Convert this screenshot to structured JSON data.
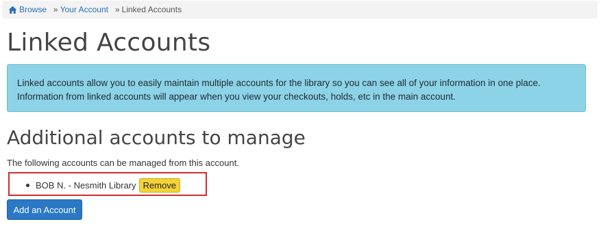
{
  "breadcrumb": {
    "home_label": "Browse",
    "home_icon": "home-icon",
    "separator": "»",
    "items": [
      {
        "label": "Your Account"
      },
      {
        "label": "Linked Accounts"
      }
    ]
  },
  "page_title": "Linked Accounts",
  "info_alert": {
    "line1": "Linked accounts allow you to easily maintain multiple accounts for the library so you can see all of your information in one place.",
    "line2": "Information from linked accounts will appear when you view your checkouts, holds, etc in the main account."
  },
  "section_heading": "Additional accounts to manage",
  "intro_text": "The following accounts can be managed from this account.",
  "linked_accounts": [
    {
      "name": "BOB N. - Nesmith Library",
      "remove_label": "Remove"
    }
  ],
  "add_account_label": "Add an Account",
  "colors": {
    "alert_bg": "#8dd3e7",
    "link": "#2a6fb8",
    "remove_button": "#f3d336",
    "primary_button": "#2a78c6",
    "highlight_border": "#d42a2a"
  }
}
